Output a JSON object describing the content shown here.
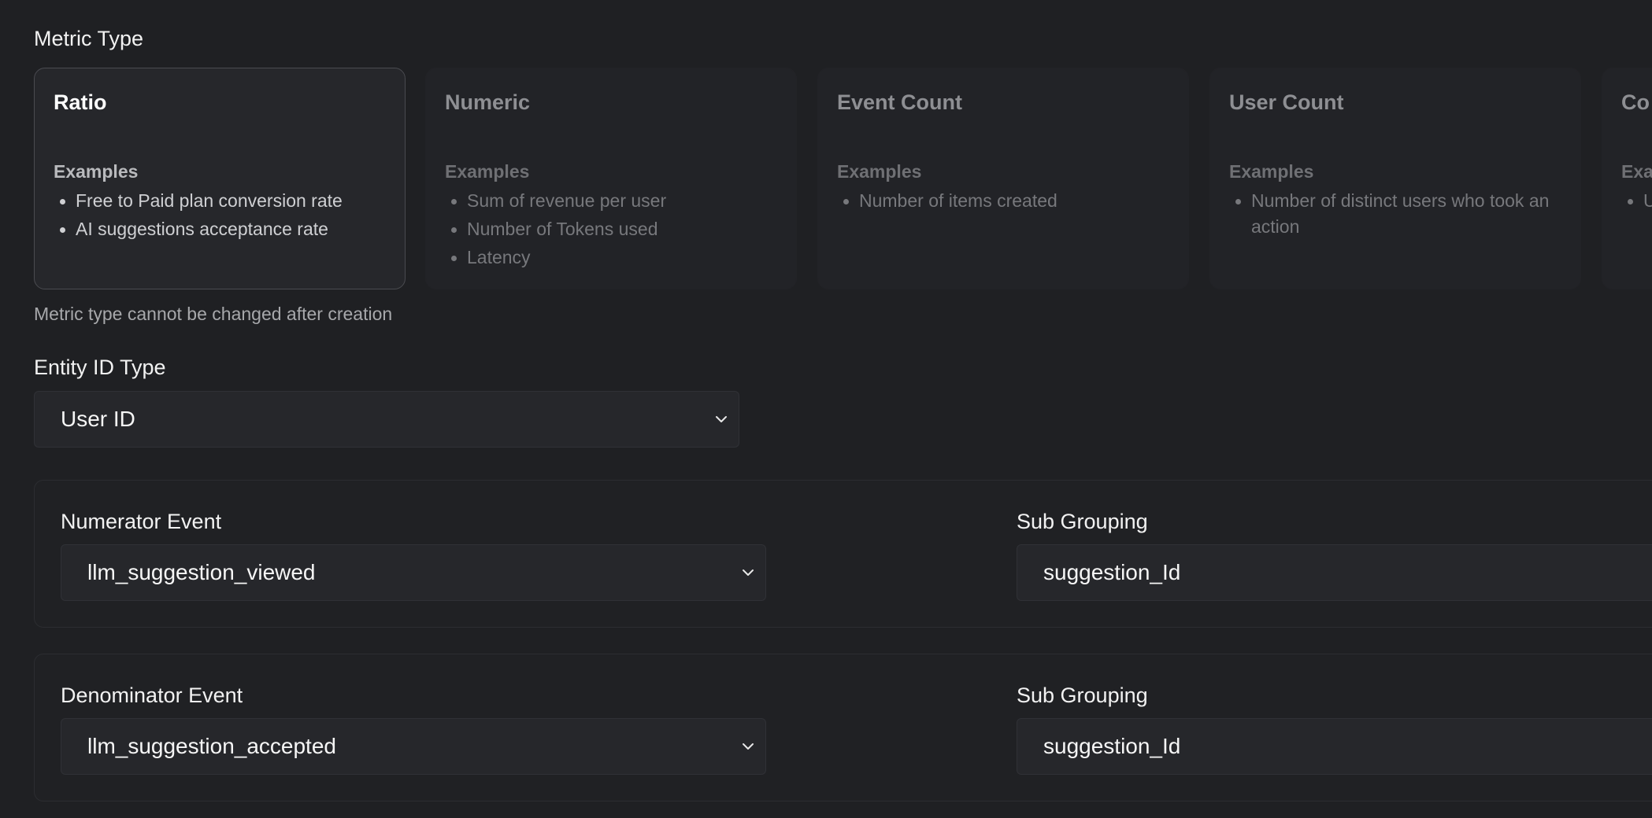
{
  "metric_type": {
    "label": "Metric Type",
    "cards": [
      {
        "title": "Ratio",
        "examples_label": "Examples",
        "examples": [
          "Free to Paid plan conversion rate",
          "AI suggestions acceptance rate"
        ],
        "selected": true
      },
      {
        "title": "Numeric",
        "examples_label": "Examples",
        "examples": [
          "Sum of revenue per user",
          "Number of Tokens used",
          "Latency"
        ],
        "selected": false
      },
      {
        "title": "Event Count",
        "examples_label": "Examples",
        "examples": [
          "Number of items created"
        ],
        "selected": false
      },
      {
        "title": "User Count",
        "examples_label": "Examples",
        "examples": [
          "Number of distinct users who took an action"
        ],
        "selected": false
      },
      {
        "title": "Co",
        "examples_label": "Exa",
        "examples": [
          "U"
        ],
        "selected": false
      }
    ],
    "hint": "Metric type cannot be changed after creation"
  },
  "entity_id_type": {
    "label": "Entity ID Type",
    "value": "User ID",
    "icon": "chevron-down-icon"
  },
  "numerator": {
    "event_label": "Numerator Event",
    "event_value": "llm_suggestion_viewed",
    "sub_grouping_label": "Sub Grouping",
    "sub_grouping_value": "suggestion_Id"
  },
  "denominator": {
    "event_label": "Denominator Event",
    "event_value": "llm_suggestion_accepted",
    "sub_grouping_label": "Sub Grouping",
    "sub_grouping_value": "suggestion_Id"
  },
  "colors": {
    "background": "#1f2023",
    "card_selected_border": "#4a4b50",
    "text_primary": "#f2f2f2",
    "text_muted": "#77787c"
  }
}
